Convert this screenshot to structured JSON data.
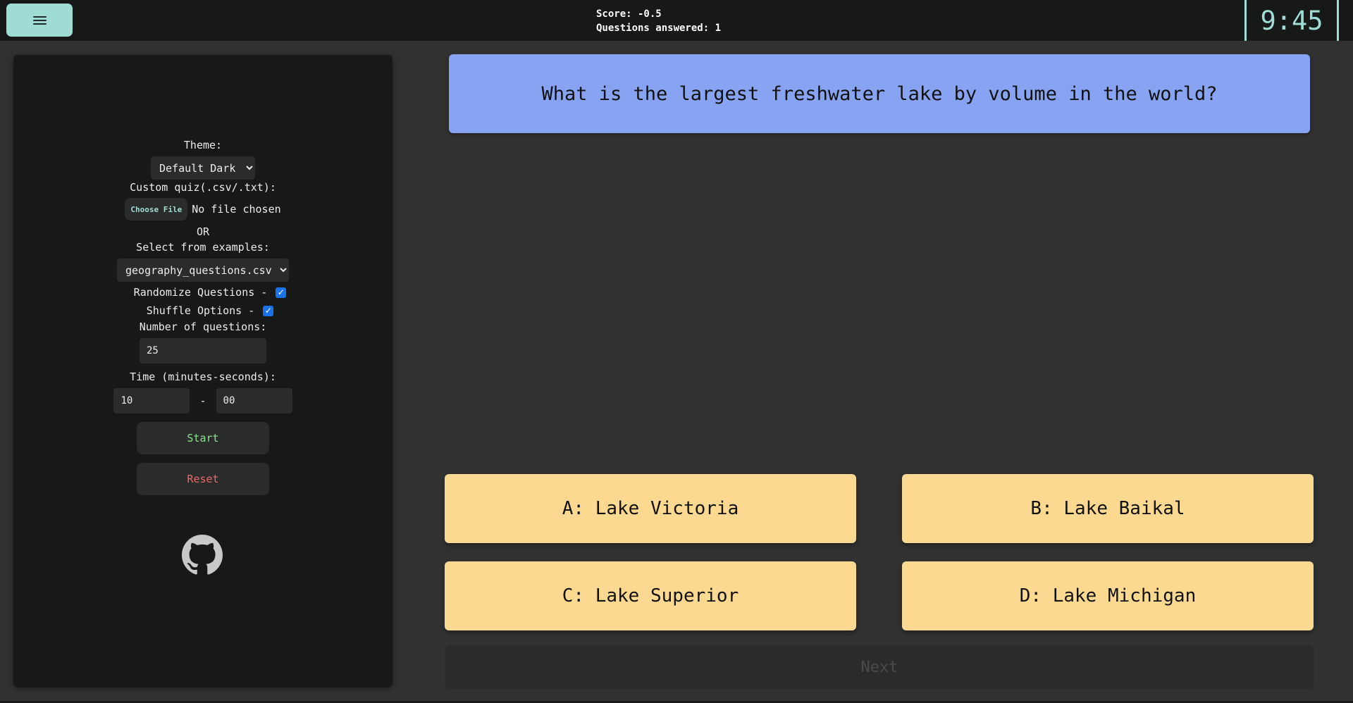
{
  "header": {
    "score": "Score: -0.5",
    "answered": "Questions answered: 1",
    "timer": "9:45"
  },
  "sidebar": {
    "theme_label": "Theme:",
    "theme_value": "Default Dark",
    "custom_quiz_label": "Custom quiz(.csv/.txt):",
    "choose_file_label": "Choose File",
    "no_file_text": "No file chosen",
    "or_text": "OR",
    "examples_label": "Select from examples:",
    "examples_value": "geography_questions.csv",
    "randomize_label": "Randomize Questions -",
    "randomize_checked": true,
    "shuffle_label": "Shuffle Options -",
    "shuffle_checked": true,
    "num_questions_label": "Number of questions:",
    "num_questions_value": "25",
    "time_label": "Time (minutes-seconds):",
    "time_minutes": "10",
    "time_separator": "-",
    "time_seconds": "00",
    "start_label": "Start",
    "reset_label": "Reset",
    "start_color": "#8ee08e",
    "reset_color": "#e86a6a"
  },
  "quiz": {
    "question": "What is the largest freshwater lake by volume in the world?",
    "options": [
      "A: Lake Victoria",
      "B: Lake Baikal",
      "C: Lake Superior",
      "D: Lake Michigan"
    ],
    "next_label": "Next"
  },
  "colors": {
    "accent": "#9fdcd4",
    "question_bg": "#87a3f1",
    "option_bg": "#fbd990"
  }
}
